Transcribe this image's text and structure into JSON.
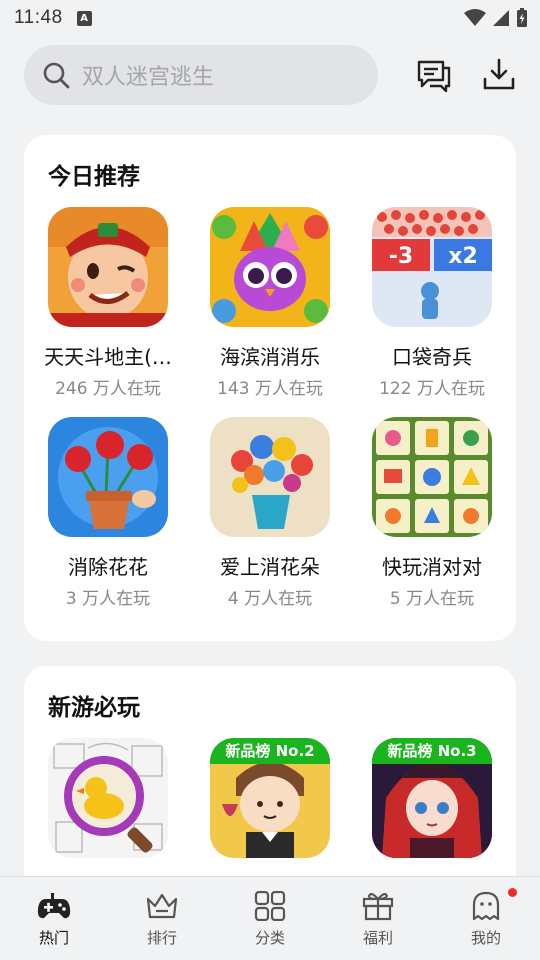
{
  "status_bar": {
    "time": "11:48",
    "notification_letter": "A"
  },
  "search": {
    "placeholder": "双人迷宫逃生"
  },
  "today": {
    "title": "今日推荐",
    "games": [
      {
        "name": "天天斗地主(…",
        "players": "246 万人在玩",
        "icon": "landlord-character-icon"
      },
      {
        "name": "海滨消消乐",
        "players": "143 万人在玩",
        "icon": "owl-match-icon"
      },
      {
        "name": "口袋奇兵",
        "players": "122 万人在玩",
        "icon": "army-multiplier-icon"
      },
      {
        "name": "消除花花",
        "players": "3 万人在玩",
        "icon": "rose-pot-icon"
      },
      {
        "name": "爱上消花朵",
        "players": "4 万人在玩",
        "icon": "flower-vase-icon"
      },
      {
        "name": "快玩消对对",
        "players": "5 万人在玩",
        "icon": "tile-match-icon"
      }
    ]
  },
  "new_games": {
    "title": "新游必玩",
    "games": [
      {
        "badge": "",
        "icon": "duck-magnifier-icon"
      },
      {
        "badge": "新品榜 No.2",
        "icon": "waiter-boy-icon"
      },
      {
        "badge": "新品榜 No.3",
        "icon": "red-hair-witch-icon"
      }
    ]
  },
  "nav": [
    {
      "label": "热门",
      "icon": "gamepad-icon",
      "active": true
    },
    {
      "label": "排行",
      "icon": "crown-icon",
      "active": false
    },
    {
      "label": "分类",
      "icon": "grid-icon",
      "active": false
    },
    {
      "label": "福利",
      "icon": "gift-icon",
      "active": false
    },
    {
      "label": "我的",
      "icon": "ghost-icon",
      "active": false
    }
  ],
  "colors": {
    "accent_green": "#19b41e",
    "notification_red": "#ef2b2b",
    "background": "#f1f2f4"
  }
}
